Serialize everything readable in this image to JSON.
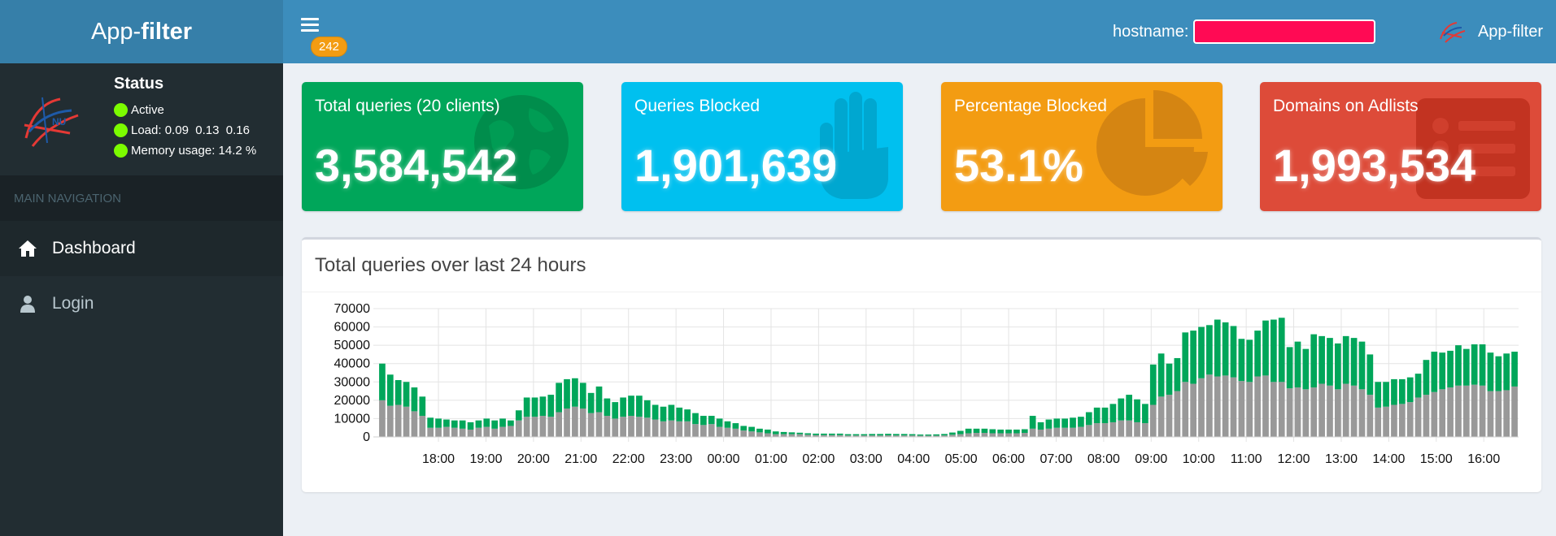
{
  "header": {
    "logo_prefix": "App-",
    "logo_bold": "filter",
    "badge_count": "242",
    "hostname_label": "hostname:",
    "user_name": "App-filter"
  },
  "sidebar": {
    "status_title": "Status",
    "status_active": "Active",
    "load_label": "Load:",
    "load_values": "0.09  0.13  0.16",
    "memory_label": "Memory usage:",
    "memory_value": "14.2 %",
    "nav_header": "MAIN NAVIGATION",
    "items": [
      {
        "label": "Dashboard",
        "icon": "home-icon"
      },
      {
        "label": "Login",
        "icon": "user-icon"
      }
    ]
  },
  "stats": [
    {
      "label": "Total queries (20 clients)",
      "value": "3,584,542",
      "color": "#00a65a",
      "icon": "globe-icon"
    },
    {
      "label": "Queries Blocked",
      "value": "1,901,639",
      "color": "#00c0ef",
      "icon": "hand-icon"
    },
    {
      "label": "Percentage Blocked",
      "value": "53.1%",
      "color": "#f39c12",
      "icon": "pie-chart-icon"
    },
    {
      "label": "Domains on Adlists",
      "value": "1,993,534",
      "color": "#dd4b39",
      "icon": "list-icon"
    }
  ],
  "chart_panel": {
    "title": "Total queries over last 24 hours"
  },
  "chart_data": {
    "type": "bar",
    "stacked": true,
    "title": "Total queries over last 24 hours",
    "ylim": [
      0,
      70000
    ],
    "yticks": [
      0,
      10000,
      20000,
      30000,
      40000,
      50000,
      60000,
      70000
    ],
    "x_tick_labels": [
      "18:00",
      "19:00",
      "20:00",
      "21:00",
      "22:00",
      "23:00",
      "00:00",
      "01:00",
      "02:00",
      "03:00",
      "04:00",
      "05:00",
      "06:00",
      "07:00",
      "08:00",
      "09:00",
      "10:00",
      "11:00",
      "12:00",
      "13:00",
      "14:00",
      "15:00",
      "16:00"
    ],
    "grid": true,
    "series": [
      {
        "color": "#999999",
        "values": [
          20000,
          17000,
          17500,
          16500,
          14000,
          11500,
          5000,
          5000,
          5500,
          5000,
          4500,
          4000,
          5000,
          5500,
          4500,
          5500,
          6000,
          9000,
          11000,
          11000,
          11500,
          11000,
          13500,
          15500,
          16500,
          15500,
          13000,
          13500,
          11500,
          10000,
          11000,
          11500,
          11000,
          10500,
          9500,
          8500,
          9000,
          8500,
          8500,
          7000,
          6500,
          7000,
          5500,
          5000,
          4500,
          3500,
          3000,
          2500,
          2000,
          1500,
          1500,
          1500,
          1500,
          1200,
          1000,
          1000,
          1000,
          1000,
          800,
          800,
          800,
          800,
          800,
          900,
          800,
          800,
          800,
          700,
          700,
          700,
          800,
          1200,
          1500,
          2000,
          2200,
          2200,
          2000,
          2000,
          2000,
          2000,
          2200,
          4500,
          4000,
          4500,
          5000,
          5000,
          5000,
          5500,
          6500,
          7500,
          7500,
          8000,
          9000,
          9000,
          8000,
          7500,
          17500,
          22000,
          23000,
          25000,
          30000,
          29000,
          32000,
          34000,
          33000,
          33500,
          32500,
          30500,
          30000,
          33000,
          33500,
          30000,
          30000,
          26500,
          27000,
          26000,
          27000,
          29000,
          28000,
          26000,
          29000,
          28000,
          26000,
          23000,
          16000,
          16500,
          17500,
          18000,
          19000,
          21500,
          23000,
          24500,
          26000,
          27000,
          28000,
          28000,
          28500,
          28000,
          25000,
          25000,
          25500,
          27500
        ]
      },
      {
        "color": "#00a65a",
        "values": [
          20000,
          17000,
          13500,
          13500,
          13000,
          10500,
          5500,
          5000,
          4000,
          4000,
          4500,
          4000,
          4000,
          4500,
          4500,
          4500,
          3000,
          5500,
          10500,
          10500,
          10500,
          12000,
          16000,
          16000,
          15500,
          14000,
          11000,
          14000,
          9500,
          9000,
          10500,
          11000,
          11500,
          9500,
          8000,
          8000,
          8500,
          7500,
          6500,
          6000,
          5000,
          4500,
          4500,
          3500,
          3000,
          2500,
          2500,
          2000,
          2000,
          1500,
          1200,
          1000,
          800,
          800,
          800,
          800,
          800,
          800,
          700,
          700,
          700,
          800,
          800,
          800,
          800,
          800,
          700,
          600,
          600,
          700,
          800,
          1200,
          1800,
          2500,
          2300,
          2300,
          2200,
          2000,
          2000,
          2000,
          2000,
          7000,
          4000,
          5000,
          5000,
          5000,
          5500,
          5500,
          7000,
          8500,
          8500,
          10000,
          12000,
          14000,
          12500,
          10500,
          22000,
          23500,
          17000,
          18000,
          27000,
          29000,
          28000,
          27000,
          31000,
          29000,
          28000,
          23000,
          23000,
          25000,
          30000,
          34000,
          35000,
          22500,
          25000,
          22000,
          29000,
          26000,
          26000,
          25000,
          26000,
          26000,
          26000,
          22000,
          14000,
          13500,
          14000,
          13500,
          13500,
          13000,
          19000,
          22000,
          20000,
          20000,
          22000,
          20000,
          22000,
          22500,
          21000,
          19000,
          20000,
          19000
        ]
      }
    ]
  }
}
